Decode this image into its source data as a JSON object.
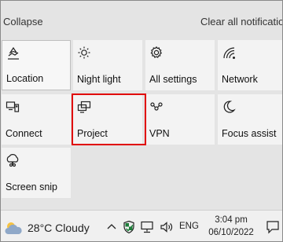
{
  "header": {
    "collapse_label": "Collapse",
    "clear_all_label": "Clear all notification"
  },
  "quick_actions": [
    {
      "label": "Location",
      "icon": "location-icon",
      "active": true
    },
    {
      "label": "Night light",
      "icon": "brightness-icon",
      "active": false
    },
    {
      "label": "All settings",
      "icon": "gear-icon",
      "active": false
    },
    {
      "label": "Network",
      "icon": "wifi-icon",
      "active": false
    },
    {
      "label": "Connect",
      "icon": "connect-icon",
      "active": false
    },
    {
      "label": "Project",
      "icon": "project-icon",
      "active": false,
      "highlighted": true
    },
    {
      "label": "VPN",
      "icon": "vpn-icon",
      "active": false
    },
    {
      "label": "Focus assist",
      "icon": "moon-icon",
      "active": false
    },
    {
      "label": "Screen snip",
      "icon": "screen-snip-icon",
      "active": false
    }
  ],
  "taskbar": {
    "weather_text": "28°C  Cloudy",
    "language": "ENG",
    "time": "3:04 pm",
    "date": "06/10/2022"
  },
  "colors": {
    "highlight": "#e00000",
    "tile_background": "#f3f3f3",
    "panel_background": "#e4e4e4"
  }
}
